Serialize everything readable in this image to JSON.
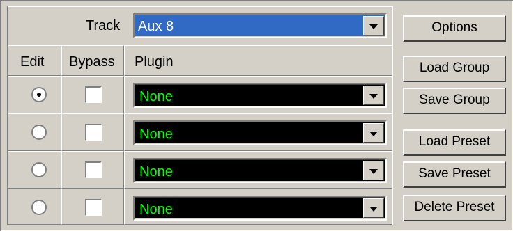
{
  "track": {
    "label": "Track",
    "value": "Aux 8"
  },
  "headers": {
    "edit": "Edit",
    "bypass": "Bypass",
    "plugin": "Plugin"
  },
  "rows": [
    {
      "edit_selected": true,
      "bypass": false,
      "plugin": "None"
    },
    {
      "edit_selected": false,
      "bypass": false,
      "plugin": "None"
    },
    {
      "edit_selected": false,
      "bypass": false,
      "plugin": "None"
    },
    {
      "edit_selected": false,
      "bypass": false,
      "plugin": "None"
    }
  ],
  "buttons": {
    "options": "Options",
    "load_group": "Load Group",
    "save_group": "Save Group",
    "load_preset": "Load Preset",
    "save_preset": "Save Preset",
    "delete_preset": "Delete Preset"
  },
  "colors": {
    "track_bg": "#316ac5",
    "plugin_bg": "#000000",
    "plugin_text": "#00ff00"
  },
  "icons": {
    "dropdown": "chevron-down-icon",
    "radio": "radio-icon",
    "checkbox": "checkbox-icon"
  }
}
